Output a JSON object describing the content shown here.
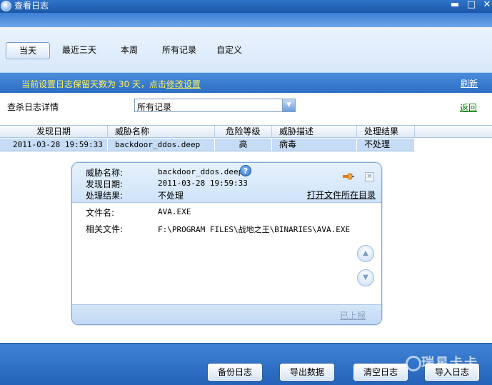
{
  "window": {
    "title": "查看日志",
    "controls": [
      "minimize",
      "maximize",
      "close"
    ]
  },
  "tabs": [
    {
      "label": "当天",
      "active": true
    },
    {
      "label": "最近三天",
      "active": false
    },
    {
      "label": "本周",
      "active": false
    },
    {
      "label": "所有记录",
      "active": false
    },
    {
      "label": "自定义",
      "active": false
    }
  ],
  "notice": {
    "text": "当前设置日志保留天数为 30 天，点击",
    "link": "修改设置",
    "refresh": "刷新"
  },
  "filter": {
    "label": "查杀日志详情",
    "selected": "所有记录",
    "back": "返回"
  },
  "table": {
    "headers": [
      "发现日期",
      "威胁名称",
      "危险等级",
      "威胁描述",
      "处理结果"
    ],
    "rows": [
      {
        "date": "2011-03-28 19:59:33",
        "name": "backdoor_ddos.deep",
        "level": "高",
        "desc": "病毒",
        "result": "不处理"
      }
    ]
  },
  "detail": {
    "threat_name_label": "威胁名称:",
    "threat_name": "backdoor_ddos.deep",
    "found_date_label": "发现日期:",
    "found_date": "2011-03-28 19:59:33",
    "result_label": "处理结果:",
    "result": "不处理",
    "open_dir": "打开文件所在目录",
    "filename_label": "文件名:",
    "filename": "AVA.EXE",
    "related_label": "相关文件:",
    "related": "F:\\PROGRAM FILES\\战地之王\\BINARIES\\AVA.EXE",
    "reported": "已上报"
  },
  "footer": {
    "buttons": [
      "备份日志",
      "导出数据",
      "清空日志",
      "导入日志"
    ],
    "watermark": "瑞星卡卡"
  },
  "colors": {
    "accent": "#2b6ec4",
    "notice_text": "#fff35a",
    "back_link": "#008000",
    "selected_row": "#c6dbf5"
  }
}
